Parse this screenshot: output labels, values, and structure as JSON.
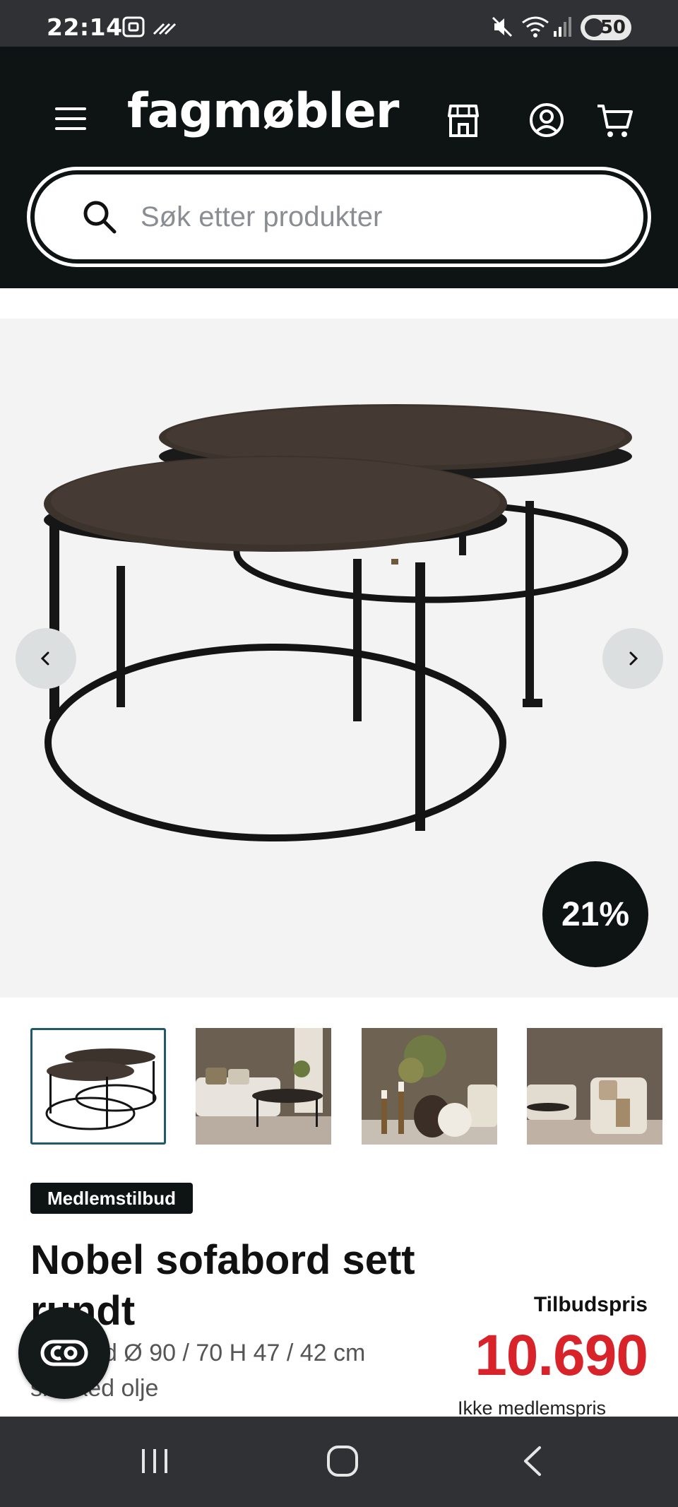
{
  "status_bar": {
    "time": "22:14",
    "battery": "50"
  },
  "header": {
    "logo": "fagmøbler",
    "icons": [
      "menu-icon",
      "store-icon",
      "account-icon",
      "cart-icon"
    ]
  },
  "search": {
    "placeholder": "Søk etter produkter",
    "value": ""
  },
  "gallery": {
    "discount_badge": "21%",
    "thumbnail_count": 4,
    "active_thumbnail": 1
  },
  "product": {
    "tag": "Medlemstilbud",
    "title": "Nobel sofabord sett rundt",
    "subtitle": "settbord Ø 90 / 70 H 47 / 42 cm smoked olje",
    "price_label": "Tilbudspris",
    "price": "10.690",
    "non_member_label": "Ikke medlemspris"
  },
  "colors": {
    "header_bg": "#0e1414",
    "price_red": "#d8232a",
    "active_thumb_border": "#1f5a68"
  }
}
